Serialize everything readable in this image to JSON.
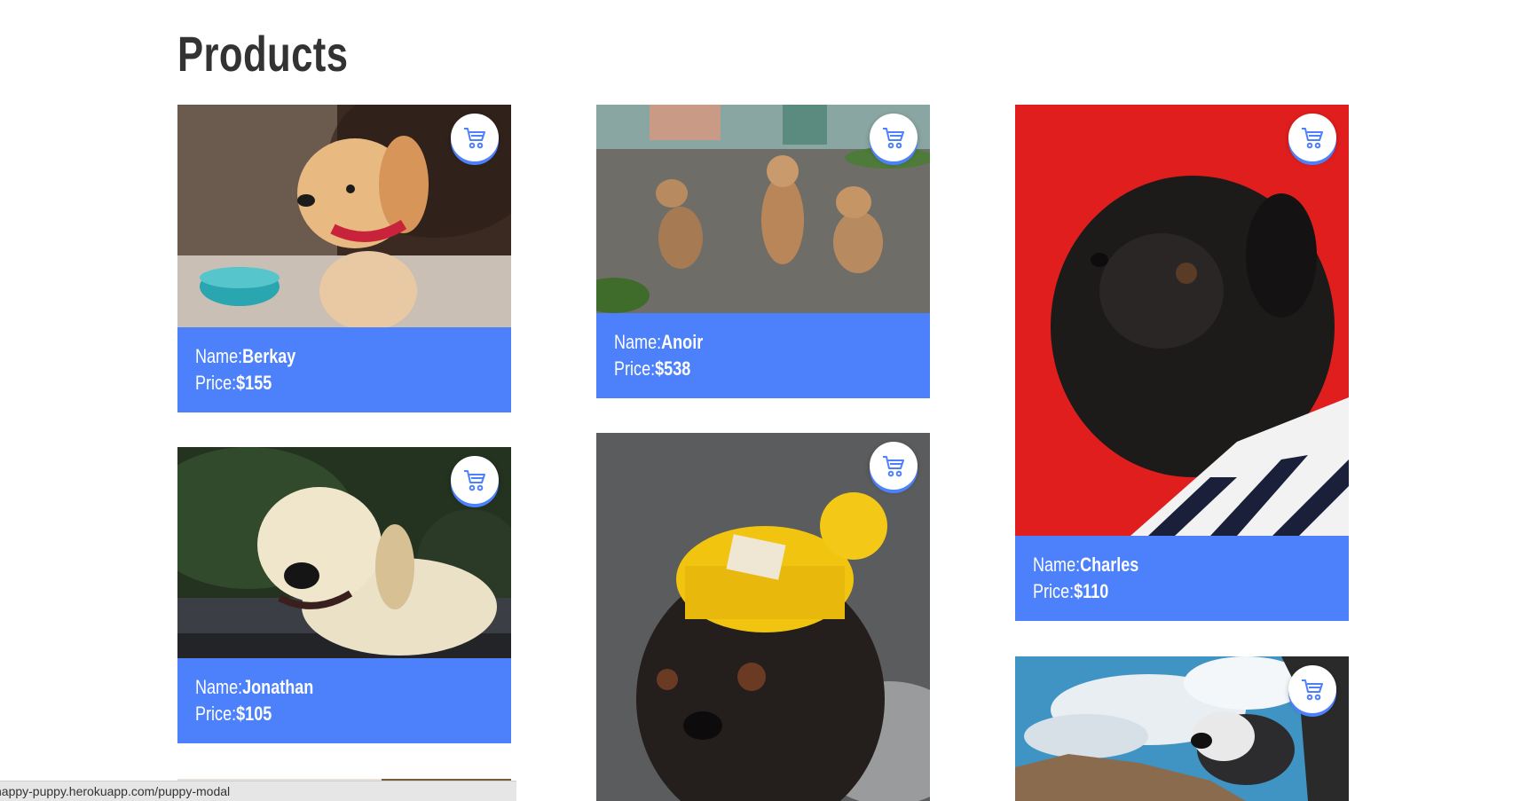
{
  "page": {
    "title": "Products"
  },
  "labels": {
    "name": "Name: ",
    "price": "Price: "
  },
  "colors": {
    "accent": "#4d80fb",
    "title": "#333333"
  },
  "products": [
    {
      "name": "Berkay",
      "price": "$155"
    },
    {
      "name": "Anoir",
      "price": "$538"
    },
    {
      "name": "Charles",
      "price": "$110"
    },
    {
      "name": "Jonathan",
      "price": "$105"
    }
  ],
  "icons": {
    "cart": "shopping-cart-icon"
  },
  "status_bar": {
    "url": "happy-puppy.herokuapp.com/puppy-modal"
  }
}
